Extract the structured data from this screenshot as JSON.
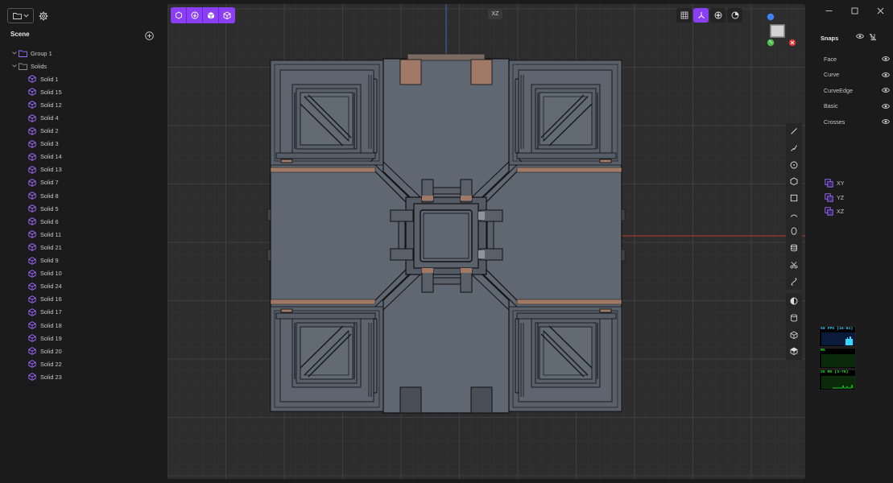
{
  "left_panel": {
    "scene_title": "Scene",
    "tree": [
      {
        "label": "Group 1",
        "kind": "group",
        "level": 1
      },
      {
        "label": "Solids",
        "kind": "folder",
        "level": 1
      },
      {
        "label": "Solid 1",
        "kind": "solid",
        "level": 2
      },
      {
        "label": "Solid 15",
        "kind": "solid",
        "level": 2
      },
      {
        "label": "Solid 12",
        "kind": "solid",
        "level": 2
      },
      {
        "label": "Solid 4",
        "kind": "solid",
        "level": 2
      },
      {
        "label": "Solid 2",
        "kind": "solid",
        "level": 2
      },
      {
        "label": "Solid 3",
        "kind": "solid",
        "level": 2
      },
      {
        "label": "Solid 14",
        "kind": "solid",
        "level": 2
      },
      {
        "label": "Solid 13",
        "kind": "solid",
        "level": 2
      },
      {
        "label": "Solid 7",
        "kind": "solid",
        "level": 2
      },
      {
        "label": "Solid 8",
        "kind": "solid",
        "level": 2
      },
      {
        "label": "Solid 5",
        "kind": "solid",
        "level": 2
      },
      {
        "label": "Solid 6",
        "kind": "solid",
        "level": 2
      },
      {
        "label": "Solid 11",
        "kind": "solid",
        "level": 2
      },
      {
        "label": "Solid 21",
        "kind": "solid",
        "level": 2
      },
      {
        "label": "Solid 9",
        "kind": "solid",
        "level": 2
      },
      {
        "label": "Solid 10",
        "kind": "solid",
        "level": 2
      },
      {
        "label": "Solid 24",
        "kind": "solid",
        "level": 2
      },
      {
        "label": "Solid 16",
        "kind": "solid",
        "level": 2
      },
      {
        "label": "Solid 17",
        "kind": "solid",
        "level": 2
      },
      {
        "label": "Solid 18",
        "kind": "solid",
        "level": 2
      },
      {
        "label": "Solid 19",
        "kind": "solid",
        "level": 2
      },
      {
        "label": "Solid 20",
        "kind": "solid",
        "level": 2
      },
      {
        "label": "Solid 22",
        "kind": "solid",
        "level": 2
      },
      {
        "label": "Solid 23",
        "kind": "solid",
        "level": 2
      }
    ]
  },
  "viewport": {
    "view_label": "XZ",
    "top_tools": [
      "solid-sketch-icon",
      "import-icon",
      "cube-solid-icon",
      "cube-outline-icon"
    ],
    "view_tools": [
      {
        "icon": "grid-icon",
        "active": false
      },
      {
        "icon": "axes-icon",
        "active": true
      },
      {
        "icon": "render-icon",
        "active": false
      },
      {
        "icon": "material-icon",
        "active": false
      }
    ],
    "side_tools": [
      "line-tool-icon",
      "polyline-tool-icon",
      "circle-tool-icon",
      "polygon-tool-icon",
      "rectangle-tool-icon",
      "arc-tool-icon",
      "ellipse-tool-icon",
      "extrude-icon",
      "trim-icon",
      "spline-icon",
      "boolean-icon",
      "cylinder-icon",
      "box-icon",
      "cube-icon"
    ]
  },
  "right_panel": {
    "snaps_title": "Snaps",
    "snaps": [
      {
        "label": "Face"
      },
      {
        "label": "Curve"
      },
      {
        "label": "CurveEdge"
      },
      {
        "label": "Basic"
      },
      {
        "label": "Crosses"
      }
    ],
    "planes": [
      "XY",
      "YZ",
      "XZ"
    ],
    "stats": [
      {
        "label": "60 FPS (16-61)",
        "color": "#39d6ff",
        "bg": "#0a1a3a"
      },
      {
        "label": "MS",
        "color": "#22ee22",
        "bg": "#0a2a0a"
      },
      {
        "label": "25 MS (3-70)",
        "color": "#22ee22",
        "bg": "#0a2a0a"
      }
    ]
  },
  "colors": {
    "accent": "#8b3ff5",
    "axis_x": "#c0392b",
    "axis_z": "#2f6bd6",
    "model_face": "#5f6773",
    "model_copper": "#a07a66"
  }
}
